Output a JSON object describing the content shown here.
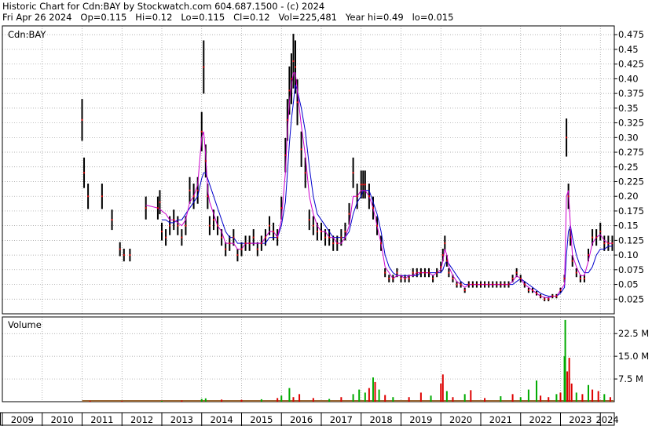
{
  "header": {
    "line1": "Historic Chart for Cdn:BAY by Stockwatch.com 604.687.1500 - (c) 2024",
    "line2": "Fri Apr 26 2024   Op=0.115   Hi=0.12   Lo=0.115   Cl=0.12   Vol=225,481   Year hi=0.49   lo=0.015"
  },
  "chart_data": [
    {
      "type": "line",
      "panel": "price",
      "title": "Cdn:BAY",
      "ylim": [
        0,
        0.49
      ],
      "y_ticks": [
        0.025,
        0.05,
        0.075,
        0.1,
        0.125,
        0.15,
        0.175,
        0.2,
        0.225,
        0.25,
        0.275,
        0.3,
        0.325,
        0.35,
        0.375,
        0.4,
        0.425,
        0.45,
        0.475
      ],
      "y_tick_labels": [
        "0.025",
        "0.05",
        "0.075",
        "0.10",
        "0.125",
        "0.15",
        "0.175",
        "0.20",
        "0.225",
        "0.25",
        "0.275",
        "0.30",
        "0.325",
        "0.35",
        "0.375",
        "0.40",
        "0.425",
        "0.45",
        "0.475"
      ],
      "x_range": [
        2009,
        2024.35
      ],
      "x_tick_labels": [
        "2009",
        "2010",
        "2011",
        "2012",
        "2013",
        "2014",
        "2015",
        "2016",
        "2017",
        "2018",
        "2019",
        "2020",
        "2021",
        "2022",
        "2023",
        "2024"
      ],
      "grid": true,
      "colors": {
        "price": "#000000",
        "close_marks": "#cc0000",
        "ma_short": "#cc00cc",
        "ma_long": "#0000cc"
      },
      "x": [
        2011.0,
        2011.05,
        2011.15,
        2011.5,
        2011.75,
        2011.95,
        2012.05,
        2012.2,
        2012.6,
        2012.9,
        2012.95,
        2013.0,
        2013.1,
        2013.2,
        2013.3,
        2013.4,
        2013.5,
        2013.6,
        2013.7,
        2013.8,
        2013.9,
        2014.0,
        2014.05,
        2014.1,
        2014.15,
        2014.2,
        2014.3,
        2014.4,
        2014.5,
        2014.6,
        2014.7,
        2014.8,
        2014.9,
        2015.0,
        2015.1,
        2015.2,
        2015.3,
        2015.4,
        2015.5,
        2015.6,
        2015.7,
        2015.8,
        2015.9,
        2016.0,
        2016.1,
        2016.15,
        2016.2,
        2016.25,
        2016.3,
        2016.35,
        2016.4,
        2016.5,
        2016.6,
        2016.7,
        2016.8,
        2016.9,
        2017.0,
        2017.1,
        2017.2,
        2017.3,
        2017.4,
        2017.5,
        2017.6,
        2017.7,
        2017.8,
        2017.9,
        2018.0,
        2018.05,
        2018.1,
        2018.2,
        2018.3,
        2018.4,
        2018.5,
        2018.6,
        2018.7,
        2018.8,
        2018.9,
        2019.0,
        2019.1,
        2019.2,
        2019.3,
        2019.4,
        2019.5,
        2019.6,
        2019.7,
        2019.8,
        2019.9,
        2020.0,
        2020.05,
        2020.1,
        2020.15,
        2020.2,
        2020.3,
        2020.4,
        2020.5,
        2020.6,
        2020.7,
        2020.8,
        2020.9,
        2021.0,
        2021.1,
        2021.2,
        2021.3,
        2021.4,
        2021.5,
        2021.6,
        2021.7,
        2021.8,
        2021.9,
        2022.0,
        2022.1,
        2022.2,
        2022.3,
        2022.4,
        2022.5,
        2022.6,
        2022.7,
        2022.8,
        2022.9,
        2023.0,
        2023.1,
        2023.15,
        2023.2,
        2023.25,
        2023.3,
        2023.4,
        2023.5,
        2023.6,
        2023.7,
        2023.8,
        2023.9,
        2024.0,
        2024.1,
        2024.2,
        2024.3
      ],
      "series": [
        {
          "role": "close",
          "values": [
            0.33,
            0.24,
            0.2,
            0.2,
            0.16,
            0.11,
            0.1,
            0.1,
            0.18,
            0.18,
            0.19,
            0.14,
            0.13,
            0.15,
            0.16,
            0.15,
            0.13,
            0.15,
            0.21,
            0.2,
            0.21,
            0.31,
            0.42,
            0.26,
            0.2,
            0.15,
            0.16,
            0.15,
            0.13,
            0.11,
            0.12,
            0.13,
            0.1,
            0.11,
            0.12,
            0.12,
            0.13,
            0.11,
            0.12,
            0.13,
            0.15,
            0.14,
            0.13,
            0.18,
            0.27,
            0.33,
            0.38,
            0.4,
            0.43,
            0.42,
            0.36,
            0.28,
            0.24,
            0.16,
            0.15,
            0.14,
            0.14,
            0.13,
            0.13,
            0.12,
            0.12,
            0.13,
            0.14,
            0.17,
            0.24,
            0.2,
            0.22,
            0.22,
            0.22,
            0.2,
            0.18,
            0.15,
            0.12,
            0.07,
            0.06,
            0.06,
            0.07,
            0.06,
            0.06,
            0.06,
            0.07,
            0.07,
            0.07,
            0.07,
            0.07,
            0.06,
            0.07,
            0.08,
            0.1,
            0.12,
            0.09,
            0.07,
            0.06,
            0.05,
            0.05,
            0.04,
            0.05,
            0.05,
            0.05,
            0.05,
            0.05,
            0.05,
            0.05,
            0.05,
            0.05,
            0.05,
            0.05,
            0.06,
            0.07,
            0.06,
            0.05,
            0.04,
            0.04,
            0.035,
            0.03,
            0.025,
            0.025,
            0.03,
            0.03,
            0.04,
            0.06,
            0.3,
            0.2,
            0.13,
            0.09,
            0.07,
            0.06,
            0.06,
            0.1,
            0.13,
            0.13,
            0.14,
            0.12,
            0.12,
            0.12
          ]
        },
        {
          "role": "ma_short",
          "values": [
            null,
            null,
            null,
            null,
            null,
            null,
            null,
            null,
            0.185,
            0.18,
            0.178,
            0.175,
            0.17,
            0.16,
            0.16,
            0.155,
            0.15,
            0.16,
            0.19,
            0.2,
            0.22,
            0.3,
            0.31,
            0.27,
            0.21,
            0.19,
            0.17,
            0.15,
            0.14,
            0.12,
            0.12,
            0.12,
            0.11,
            0.11,
            0.12,
            0.12,
            0.12,
            0.12,
            0.12,
            0.13,
            0.14,
            0.14,
            0.13,
            0.16,
            0.24,
            0.31,
            0.36,
            0.39,
            0.41,
            0.41,
            0.38,
            0.32,
            0.27,
            0.2,
            0.17,
            0.15,
            0.14,
            0.14,
            0.13,
            0.13,
            0.12,
            0.12,
            0.13,
            0.15,
            0.2,
            0.2,
            0.21,
            0.21,
            0.21,
            0.2,
            0.18,
            0.15,
            0.12,
            0.08,
            0.07,
            0.06,
            0.065,
            0.065,
            0.06,
            0.065,
            0.065,
            0.07,
            0.07,
            0.07,
            0.07,
            0.065,
            0.07,
            0.075,
            0.09,
            0.11,
            0.1,
            0.08,
            0.065,
            0.055,
            0.05,
            0.045,
            0.05,
            0.05,
            0.05,
            0.05,
            0.05,
            0.05,
            0.05,
            0.05,
            0.05,
            0.05,
            0.05,
            0.055,
            0.065,
            0.06,
            0.05,
            0.045,
            0.04,
            0.035,
            0.03,
            0.028,
            0.027,
            0.03,
            0.03,
            0.04,
            0.05,
            0.2,
            0.21,
            0.15,
            0.1,
            0.08,
            0.065,
            0.065,
            0.09,
            0.12,
            0.13,
            0.135,
            0.125,
            0.12,
            0.12
          ]
        },
        {
          "role": "ma_long",
          "values": [
            null,
            null,
            null,
            null,
            null,
            null,
            null,
            null,
            null,
            null,
            null,
            0.16,
            0.16,
            0.155,
            0.155,
            0.16,
            0.16,
            0.17,
            0.18,
            0.19,
            0.2,
            0.23,
            0.24,
            0.24,
            0.23,
            0.22,
            0.2,
            0.18,
            0.16,
            0.14,
            0.13,
            0.13,
            0.12,
            0.12,
            0.12,
            0.12,
            0.12,
            0.12,
            0.12,
            0.12,
            0.13,
            0.13,
            0.13,
            0.15,
            0.19,
            0.24,
            0.29,
            0.33,
            0.36,
            0.39,
            0.38,
            0.35,
            0.31,
            0.25,
            0.2,
            0.17,
            0.16,
            0.15,
            0.14,
            0.13,
            0.13,
            0.13,
            0.13,
            0.14,
            0.17,
            0.19,
            0.2,
            0.21,
            0.21,
            0.21,
            0.19,
            0.17,
            0.14,
            0.1,
            0.08,
            0.07,
            0.065,
            0.065,
            0.065,
            0.065,
            0.065,
            0.065,
            0.07,
            0.07,
            0.07,
            0.07,
            0.07,
            0.07,
            0.075,
            0.085,
            0.09,
            0.085,
            0.075,
            0.065,
            0.055,
            0.05,
            0.05,
            0.05,
            0.05,
            0.05,
            0.05,
            0.05,
            0.05,
            0.05,
            0.05,
            0.05,
            0.05,
            0.05,
            0.055,
            0.06,
            0.055,
            0.05,
            0.045,
            0.04,
            0.035,
            0.032,
            0.03,
            0.03,
            0.03,
            0.035,
            0.045,
            0.1,
            0.14,
            0.15,
            0.13,
            0.1,
            0.08,
            0.07,
            0.07,
            0.08,
            0.1,
            0.11,
            0.11,
            0.115,
            0.115
          ]
        }
      ]
    },
    {
      "type": "bar",
      "panel": "volume",
      "title": "Volume",
      "ylim": [
        0,
        28000000
      ],
      "y_ticks": [
        7500000,
        15000000,
        22500000
      ],
      "y_tick_labels": [
        "7.5 M",
        "15.0 M",
        "22.5 M"
      ],
      "colors": {
        "up": "#00aa00",
        "down": "#dd0000"
      },
      "bars": [
        {
          "x": 2011.2,
          "value": 300000,
          "dir": "down"
        },
        {
          "x": 2012.0,
          "value": 200000,
          "dir": "down"
        },
        {
          "x": 2013.0,
          "value": 250000,
          "dir": "up"
        },
        {
          "x": 2013.5,
          "value": 400000,
          "dir": "down"
        },
        {
          "x": 2014.0,
          "value": 900000,
          "dir": "up"
        },
        {
          "x": 2014.1,
          "value": 1100000,
          "dir": "up"
        },
        {
          "x": 2014.5,
          "value": 700000,
          "dir": "down"
        },
        {
          "x": 2015.0,
          "value": 600000,
          "dir": "down"
        },
        {
          "x": 2015.5,
          "value": 800000,
          "dir": "up"
        },
        {
          "x": 2015.9,
          "value": 1200000,
          "dir": "down"
        },
        {
          "x": 2016.0,
          "value": 2000000,
          "dir": "up"
        },
        {
          "x": 2016.2,
          "value": 4500000,
          "dir": "up"
        },
        {
          "x": 2016.3,
          "value": 1500000,
          "dir": "down"
        },
        {
          "x": 2016.45,
          "value": 2500000,
          "dir": "down"
        },
        {
          "x": 2016.8,
          "value": 1200000,
          "dir": "down"
        },
        {
          "x": 2017.2,
          "value": 900000,
          "dir": "up"
        },
        {
          "x": 2017.5,
          "value": 1500000,
          "dir": "down"
        },
        {
          "x": 2017.8,
          "value": 2500000,
          "dir": "up"
        },
        {
          "x": 2017.95,
          "value": 4000000,
          "dir": "up"
        },
        {
          "x": 2018.1,
          "value": 3000000,
          "dir": "up"
        },
        {
          "x": 2018.2,
          "value": 4500000,
          "dir": "down"
        },
        {
          "x": 2018.3,
          "value": 8000000,
          "dir": "up"
        },
        {
          "x": 2018.35,
          "value": 6500000,
          "dir": "down"
        },
        {
          "x": 2018.45,
          "value": 4000000,
          "dir": "up"
        },
        {
          "x": 2018.6,
          "value": 2200000,
          "dir": "down"
        },
        {
          "x": 2018.8,
          "value": 1500000,
          "dir": "up"
        },
        {
          "x": 2019.2,
          "value": 1500000,
          "dir": "down"
        },
        {
          "x": 2019.5,
          "value": 3000000,
          "dir": "down"
        },
        {
          "x": 2019.75,
          "value": 2000000,
          "dir": "up"
        },
        {
          "x": 2020.0,
          "value": 6000000,
          "dir": "down"
        },
        {
          "x": 2020.05,
          "value": 9000000,
          "dir": "down"
        },
        {
          "x": 2020.15,
          "value": 3500000,
          "dir": "up"
        },
        {
          "x": 2020.3,
          "value": 1500000,
          "dir": "down"
        },
        {
          "x": 2020.6,
          "value": 2500000,
          "dir": "up"
        },
        {
          "x": 2020.75,
          "value": 3800000,
          "dir": "down"
        },
        {
          "x": 2021.1,
          "value": 1200000,
          "dir": "down"
        },
        {
          "x": 2021.5,
          "value": 1800000,
          "dir": "up"
        },
        {
          "x": 2021.8,
          "value": 2500000,
          "dir": "down"
        },
        {
          "x": 2022.0,
          "value": 1500000,
          "dir": "up"
        },
        {
          "x": 2022.2,
          "value": 4000000,
          "dir": "up"
        },
        {
          "x": 2022.4,
          "value": 7000000,
          "dir": "up"
        },
        {
          "x": 2022.5,
          "value": 2000000,
          "dir": "down"
        },
        {
          "x": 2022.7,
          "value": 1500000,
          "dir": "down"
        },
        {
          "x": 2022.9,
          "value": 2500000,
          "dir": "up"
        },
        {
          "x": 2023.0,
          "value": 3000000,
          "dir": "down"
        },
        {
          "x": 2023.1,
          "value": 15000000,
          "dir": "up"
        },
        {
          "x": 2023.12,
          "value": 27000000,
          "dir": "up"
        },
        {
          "x": 2023.17,
          "value": 10000000,
          "dir": "down"
        },
        {
          "x": 2023.22,
          "value": 14500000,
          "dir": "down"
        },
        {
          "x": 2023.28,
          "value": 6000000,
          "dir": "down"
        },
        {
          "x": 2023.4,
          "value": 3000000,
          "dir": "up"
        },
        {
          "x": 2023.55,
          "value": 2500000,
          "dir": "down"
        },
        {
          "x": 2023.7,
          "value": 5500000,
          "dir": "up"
        },
        {
          "x": 2023.8,
          "value": 4000000,
          "dir": "down"
        },
        {
          "x": 2023.95,
          "value": 3500000,
          "dir": "down"
        },
        {
          "x": 2024.1,
          "value": 2500000,
          "dir": "up"
        },
        {
          "x": 2024.25,
          "value": 1500000,
          "dir": "down"
        }
      ]
    }
  ]
}
